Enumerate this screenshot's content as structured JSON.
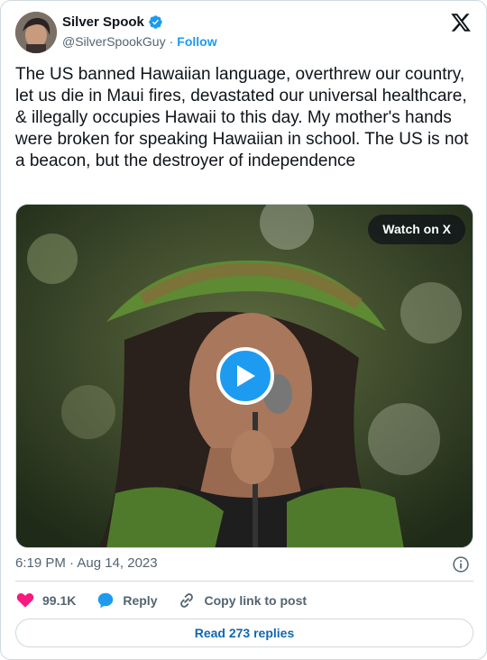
{
  "author": {
    "name": "Silver Spook",
    "handle": "@SilverSpookGuy",
    "separator": "·",
    "follow_label": "Follow"
  },
  "tweet": {
    "text": "The US banned Hawaiian language, overthrew our country, let us die in Maui fires, devastated our universal healthcare, & illegally occupies Hawaii to this day. My mother's hands were broken for speaking Hawaiian in school. The US is not a beacon, but the destroyer of independence"
  },
  "media": {
    "watch_label": "Watch on X"
  },
  "timestamp": "6:19 PM · Aug 14, 2023",
  "actions": {
    "likes": "99.1K",
    "reply_label": "Reply",
    "copy_label": "Copy link to post"
  },
  "read_replies_label": "Read 273 replies",
  "colors": {
    "accent": "#1d9bf0",
    "like": "#f91880",
    "text_secondary": "#536471",
    "border": "#cfd9de"
  },
  "icons": [
    "verified-badge-icon",
    "x-logo-icon",
    "play-icon",
    "info-icon",
    "heart-icon",
    "reply-bubble-icon",
    "link-icon"
  ]
}
